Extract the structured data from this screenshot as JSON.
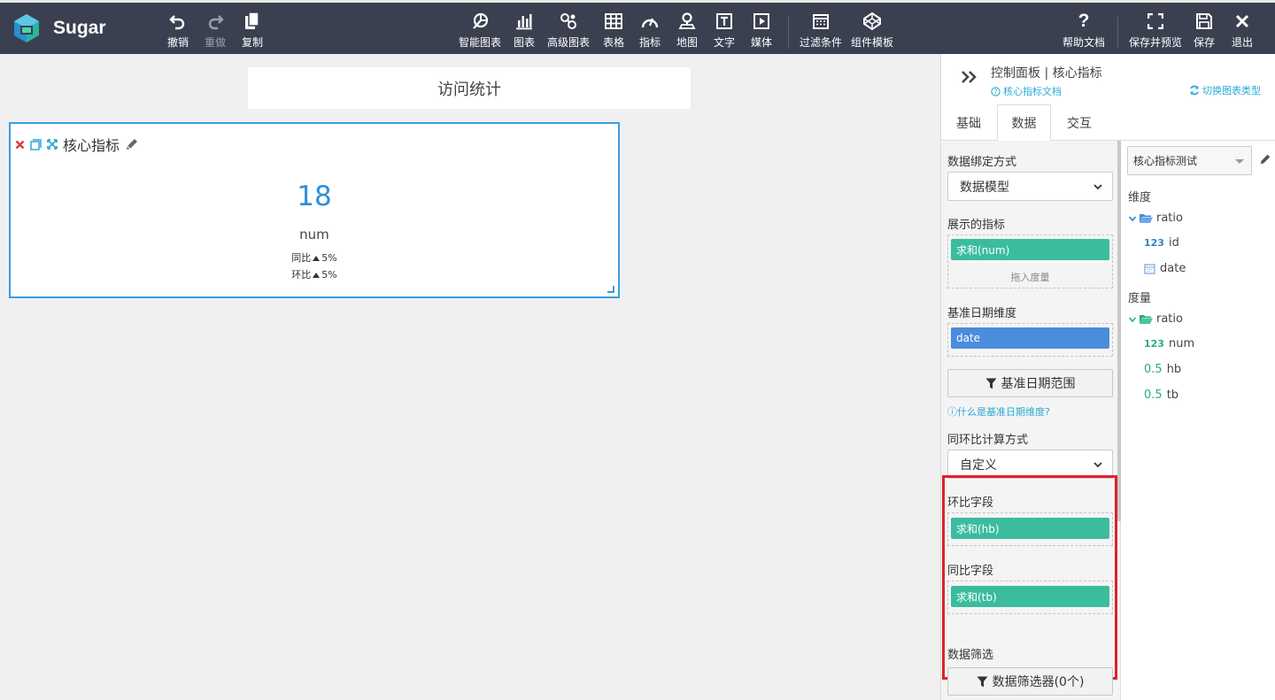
{
  "app": {
    "brand": "Sugar"
  },
  "toolbar": {
    "undo": "撤销",
    "redo": "重做",
    "copy": "复制",
    "smart_chart": "智能图表",
    "chart": "图表",
    "advanced_chart": "高级图表",
    "table": "表格",
    "metric": "指标",
    "map": "地图",
    "text": "文字",
    "media": "媒体",
    "filter": "过滤条件",
    "component_template": "组件模板",
    "help": "帮助文档",
    "save_preview": "保存并预览",
    "save": "保存",
    "exit": "退出"
  },
  "canvas": {
    "page_title": "访问统计",
    "widget": {
      "title": "核心指标",
      "value": "18",
      "name": "num",
      "yoy_label": "同比",
      "yoy_value": "5%",
      "mom_label": "环比",
      "mom_value": "5%"
    }
  },
  "panel": {
    "title": "控制面板 | 核心指标",
    "doc_link": "核心指标文档",
    "switch_type": "切换图表类型",
    "tabs": [
      "基础",
      "数据",
      "交互"
    ],
    "active_tab": "数据",
    "config": {
      "binding_label": "数据绑定方式",
      "binding_value": "数据模型",
      "metrics_label": "展示的指标",
      "metric_chip": "求和(num)",
      "metric_hint": "拖入度量",
      "date_dim_label": "基准日期维度",
      "date_chip": "date",
      "date_range_btn": "基准日期范围",
      "date_help": "什么是基准日期维度?",
      "calc_label": "同环比计算方式",
      "calc_value": "自定义",
      "mom_field_label": "环比字段",
      "mom_chip": "求和(hb)",
      "yoy_field_label": "同比字段",
      "yoy_chip": "求和(tb)",
      "filter_label": "数据筛选",
      "filter_btn": "数据筛选器(0个)"
    },
    "model": {
      "selected": "核心指标测试",
      "dimensions_label": "维度",
      "dim_folder": "ratio",
      "dim_fields": [
        {
          "type": "123",
          "name": "id"
        },
        {
          "type": "date",
          "name": "date"
        }
      ],
      "measures_label": "度量",
      "measure_folder": "ratio",
      "measure_fields": [
        {
          "type": "123",
          "name": "num"
        },
        {
          "type": "0.5",
          "name": "hb"
        },
        {
          "type": "0.5",
          "name": "tb"
        }
      ]
    }
  }
}
